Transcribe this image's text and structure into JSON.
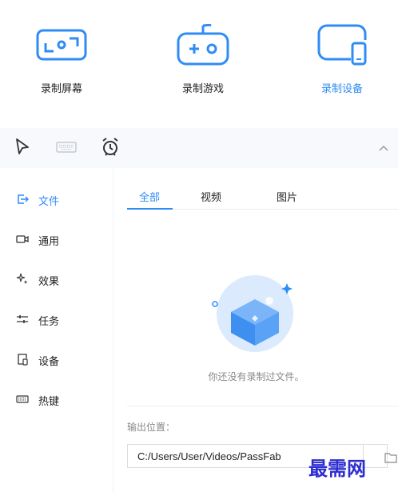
{
  "modes": [
    {
      "label": "录制屏幕",
      "icon": "screen-record-icon",
      "active": false
    },
    {
      "label": "录制游戏",
      "icon": "gamepad-icon",
      "active": false
    },
    {
      "label": "录制设备",
      "icon": "device-icon",
      "active": true
    }
  ],
  "toolbar": {
    "icons": [
      "cursor-icon",
      "keyboard-icon",
      "alarm-clock-icon",
      "chevron-up-icon"
    ]
  },
  "sidebar": {
    "items": [
      {
        "label": "文件",
        "icon": "file-export-icon",
        "active": true
      },
      {
        "label": "通用",
        "icon": "camera-icon",
        "active": false
      },
      {
        "label": "效果",
        "icon": "sparkle-icon",
        "active": false
      },
      {
        "label": "任务",
        "icon": "sliders-icon",
        "active": false
      },
      {
        "label": "设备",
        "icon": "device-icon",
        "active": false
      },
      {
        "label": "热键",
        "icon": "keyboard-icon",
        "active": false
      }
    ]
  },
  "main": {
    "tabs": [
      {
        "label": "全部",
        "active": true
      },
      {
        "label": "视频",
        "active": false
      },
      {
        "label": "图片",
        "active": false
      }
    ],
    "empty_text": "你还没有录制过文件。",
    "output_label": "输出位置：",
    "output_path": "C:/Users/User/Videos/PassFab"
  },
  "watermark": "最需网",
  "colors": {
    "accent": "#2f8bf6",
    "toolbar_bg": "#f7f9fc"
  }
}
